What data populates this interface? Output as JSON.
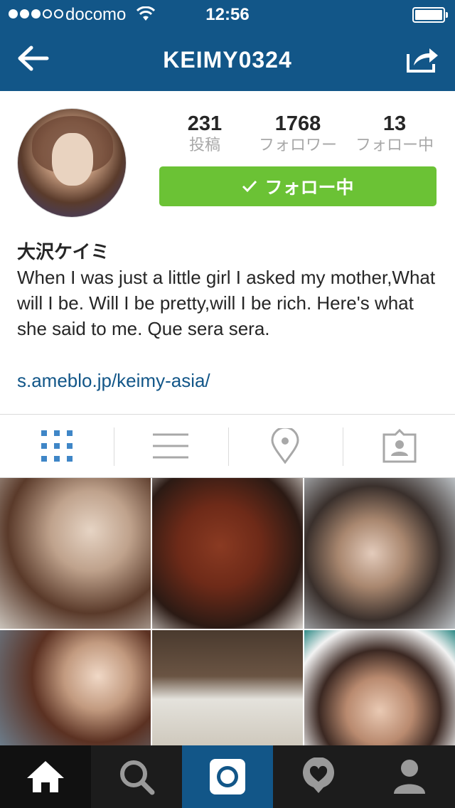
{
  "status_bar": {
    "carrier": "docomo",
    "time": "12:56",
    "signal_bars_filled": 3,
    "signal_bars_total": 5
  },
  "nav": {
    "title": "KEIMY0324",
    "back_icon": "back-arrow-icon",
    "share_icon": "share-icon"
  },
  "profile": {
    "posts_count": "231",
    "posts_label": "投稿",
    "followers_count": "1768",
    "followers_label": "フォロワー",
    "following_count": "13",
    "following_label": "フォロー中",
    "follow_button_label": "フォロー中",
    "name": "大沢ケイミ",
    "bio": "When I was just a little girl I asked my mother,What will I be. Will I be pretty,will I be rich. Here's what she said to me. Que sera sera.",
    "link": "s.ameblo.jp/keimy-asia/"
  },
  "view_tabs": [
    {
      "icon": "grid-view-icon",
      "active": true
    },
    {
      "icon": "list-view-icon",
      "active": false
    },
    {
      "icon": "location-pin-icon",
      "active": false
    },
    {
      "icon": "tagged-photos-icon",
      "active": false
    }
  ],
  "bottom_nav": [
    {
      "icon": "home-icon",
      "active": true
    },
    {
      "icon": "search-icon",
      "active": false
    },
    {
      "icon": "camera-icon",
      "active": false
    },
    {
      "icon": "activity-heart-icon",
      "active": false
    },
    {
      "icon": "profile-icon",
      "active": false
    }
  ],
  "colors": {
    "header_blue": "#125688",
    "follow_green": "#6bc235",
    "link_blue": "#125688",
    "tab_active_blue": "#3f86c7",
    "tab_inactive_gray": "#a8a8a8"
  }
}
